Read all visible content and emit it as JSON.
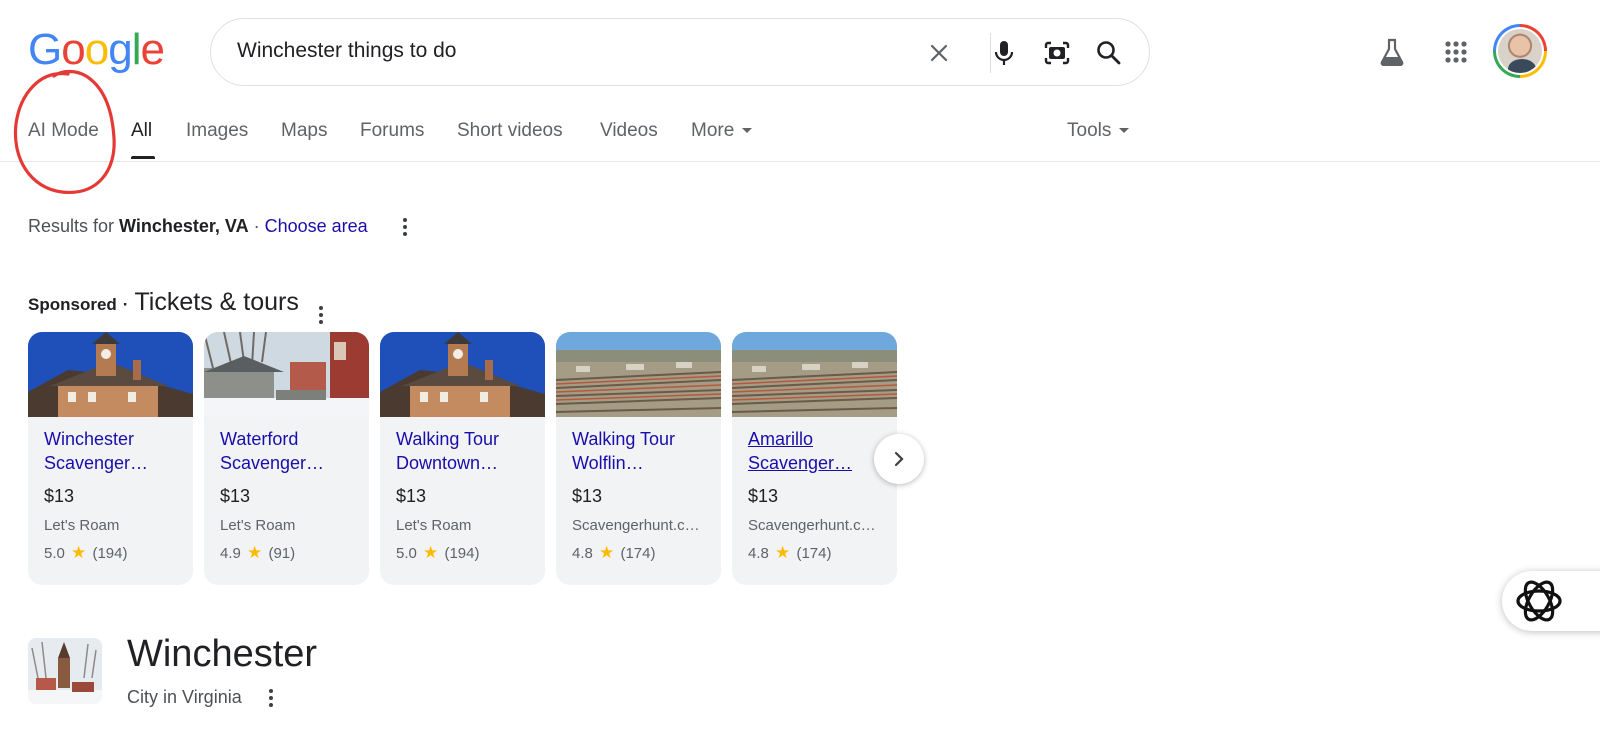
{
  "logo": [
    "G",
    "o",
    "o",
    "g",
    "l",
    "e"
  ],
  "logo_colors": [
    "#4285f4",
    "#ea4335",
    "#fbbc05",
    "#4285f4",
    "#34a853",
    "#ea4335"
  ],
  "search": {
    "query": "Winchester things to do"
  },
  "icons": {
    "clear": "close-icon",
    "voice": "microphone-icon",
    "lens": "camera-lens-icon",
    "search": "search-icon",
    "labs": "flask-icon",
    "apps": "apps-grid-icon"
  },
  "tabs": [
    {
      "label": "AI Mode"
    },
    {
      "label": "All",
      "active": true
    },
    {
      "label": "Images"
    },
    {
      "label": "Maps"
    },
    {
      "label": "Forums"
    },
    {
      "label": "Short videos"
    },
    {
      "label": "Videos"
    },
    {
      "label": "More"
    }
  ],
  "tools_label": "Tools",
  "location": {
    "prefix": "Results for",
    "place": "Winchester, VA",
    "separator": "·",
    "choose_area": "Choose area"
  },
  "sponsored": {
    "label": "Sponsored",
    "separator": "·",
    "title": "Tickets & tours"
  },
  "cards": [
    {
      "title": "Winchester Scavenger…",
      "price": "$13",
      "vendor": "Let's Roam",
      "rating": "5.0",
      "reviews": "(194)"
    },
    {
      "title": "Waterford Scavenger…",
      "price": "$13",
      "vendor": "Let's Roam",
      "rating": "4.9",
      "reviews": "(91)"
    },
    {
      "title": "Walking Tour Downtown…",
      "price": "$13",
      "vendor": "Let's Roam",
      "rating": "5.0",
      "reviews": "(194)"
    },
    {
      "title": "Walking Tour Wolflin…",
      "price": "$13",
      "vendor": "Scavengerhunt.c…",
      "rating": "4.8",
      "reviews": "(174)"
    },
    {
      "title": "Amarillo Scavenger…",
      "price": "$13",
      "vendor": "Scavengerhunt.c…",
      "rating": "4.8",
      "reviews": "(174)"
    }
  ],
  "knowledge": {
    "title": "Winchester",
    "subtitle": "City in Virginia"
  },
  "colors": {
    "link": "#1a0dab",
    "star": "#fbbc04",
    "annotation": "#e53935"
  }
}
